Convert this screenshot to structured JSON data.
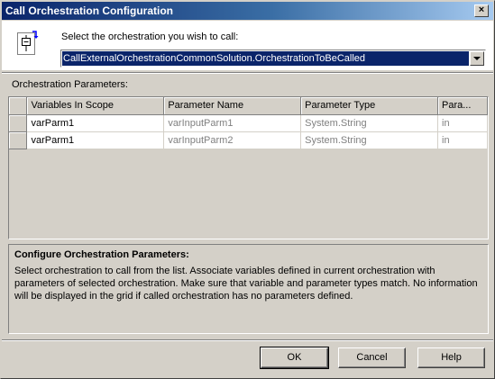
{
  "window": {
    "title": "Call Orchestration Configuration",
    "close_symbol": "×"
  },
  "selector": {
    "label": "Select the orchestration you wish to call:",
    "selected": "CallExternalOrchestrationCommonSolution.OrchestrationToBeCalled"
  },
  "params": {
    "label": "Orchestration Parameters:",
    "columns": [
      "Variables In Scope",
      "Parameter Name",
      "Parameter Type",
      "Para..."
    ],
    "rows": [
      [
        "varParm1",
        "varInputParm1",
        "System.String",
        "in"
      ],
      [
        "varParm1",
        "varInputParm2",
        "System.String",
        "in"
      ]
    ]
  },
  "help": {
    "title": "Configure Orchestration Parameters:",
    "text": "Select orchestration to call from the list. Associate variables defined in current orchestration with parameters of selected orchestration. Make sure that variable and parameter types match. No information will be displayed in the grid if called orchestration has no parameters defined."
  },
  "buttons": {
    "ok": "OK",
    "cancel": "Cancel",
    "help": "Help"
  },
  "icons": {
    "orchestration": "orchestration-call-icon",
    "dropdown": "chevron-down-icon",
    "close": "close-icon"
  },
  "colors": {
    "title_start": "#0a246a",
    "title_end": "#a6caf0",
    "selection": "#0a246a",
    "face": "#d4d0c8"
  }
}
